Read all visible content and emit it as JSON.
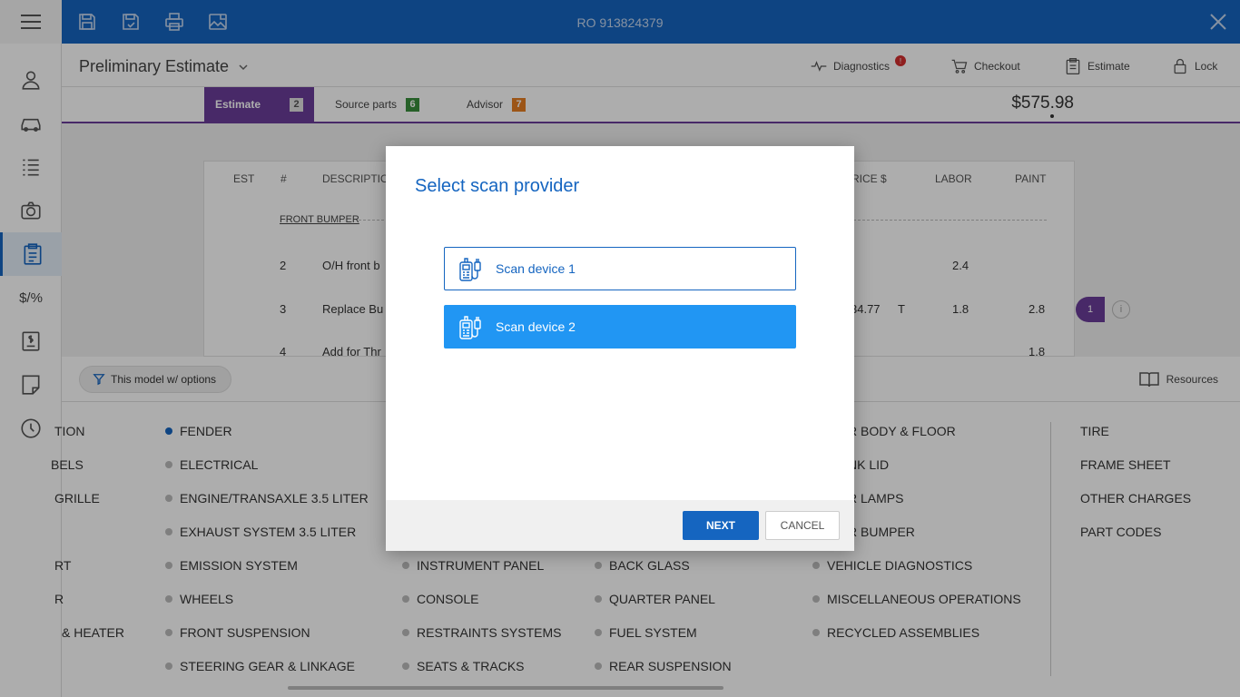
{
  "topbar": {
    "ro_title": "RO 913824379"
  },
  "header": {
    "title": "Preliminary Estimate",
    "actions": {
      "diagnostics": "Diagnostics",
      "diagnostics_badge": "!",
      "checkout": "Checkout",
      "estimate": "Estimate",
      "lock": "Lock"
    }
  },
  "tabs": [
    {
      "label": "Estimate",
      "count": "2",
      "color": "#9e9e9e"
    },
    {
      "label": "Source parts",
      "count": "6",
      "color": "#388e3c"
    },
    {
      "label": "Advisor",
      "count": "7",
      "color": "#e67e22"
    }
  ],
  "total": "$575.98",
  "sidebar": {
    "items": [
      "person-icon",
      "car-icon",
      "list-icon",
      "camera-icon",
      "clipboard-icon",
      "discount-icon",
      "invoice-icon",
      "note-icon",
      "history-icon"
    ],
    "discount_text": "$/%"
  },
  "table": {
    "headers": {
      "est": "EST",
      "num": "#",
      "desc": "DESCRIPTION",
      "price": "PRICE $",
      "labor": "LABOR",
      "paint": "PAINT"
    },
    "section": "FRONT BUMPER",
    "rows": [
      {
        "num": "2",
        "desc": "O/H front b",
        "price": "",
        "type": "",
        "labor": "2.4",
        "paint": ""
      },
      {
        "num": "3",
        "desc": "Replace Bu",
        "price": "34.77",
        "type": "T",
        "labor": "1.8",
        "paint": "2.8"
      },
      {
        "num": "4",
        "desc": "Add for Thr",
        "price": "",
        "type": "",
        "labor": "",
        "paint": "1.8"
      }
    ],
    "pill": "1",
    "info": "i"
  },
  "filter": {
    "chip": "This model w/ options",
    "resources": "Resources"
  },
  "categories": {
    "col0": [
      "TION",
      "BELS",
      "GRILLE",
      "",
      "RT",
      "R",
      "& HEATER"
    ],
    "col1": [
      "FENDER",
      "ELECTRICAL",
      "ENGINE/TRANSAXLE 3.5 LITER",
      "EXHAUST SYSTEM 3.5 LITER",
      "EMISSION SYSTEM",
      "WHEELS",
      "FRONT SUSPENSION",
      "STEERING GEAR & LINKAGE"
    ],
    "col2": [
      "INSTRUMENT PANEL",
      "CONSOLE",
      "RESTRAINTS SYSTEMS",
      "SEATS & TRACKS"
    ],
    "col3": [
      "BACK GLASS",
      "QUARTER PANEL",
      "FUEL SYSTEM",
      "REAR SUSPENSION"
    ],
    "col4": [
      "R BODY & FLOOR",
      "NK LID",
      "R LAMPS",
      "R BUMPER",
      "VEHICLE DIAGNOSTICS",
      "MISCELLANEOUS OPERATIONS",
      "RECYCLED ASSEMBLIES"
    ],
    "col5": [
      "TIRE",
      "FRAME SHEET",
      "OTHER CHARGES",
      "PART CODES"
    ]
  },
  "dialog": {
    "title": "Select scan provider",
    "providers": [
      "Scan device 1",
      "Scan device 2"
    ],
    "next": "NEXT",
    "cancel": "CANCEL"
  }
}
